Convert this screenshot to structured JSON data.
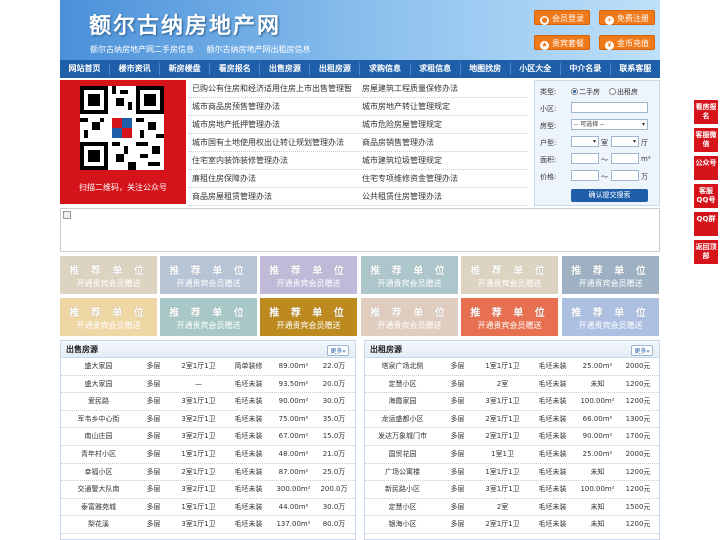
{
  "header": {
    "title": "额尔古纳房地产网",
    "subtitle": [
      "额尔古纳房地产网二手房信息",
      "额尔古纳房地产网出租房信息"
    ],
    "buttons": [
      {
        "label": "会员登录"
      },
      {
        "label": "免费注册"
      },
      {
        "label": "贵宾套餐"
      },
      {
        "label": "金币充值"
      }
    ]
  },
  "nav": [
    "网站首页",
    "楼市资讯",
    "新房楼盘",
    "看房报名",
    "出售房源",
    "出租房源",
    "求购信息",
    "求租信息",
    "地图找房",
    "小区大全",
    "中介名录",
    "联系客服"
  ],
  "qr": {
    "caption": "扫描二维码，关注公众号"
  },
  "links": [
    [
      "已购公有住房和经济适用住房上市出售管理暂",
      "房屋建筑工程质量保修办法"
    ],
    [
      "城市商品房预售管理办法",
      "城市房地产转让管理规定"
    ],
    [
      "城市房地产抵押管理办法",
      "城市危险房屋管理规定"
    ],
    [
      "城市国有土地使用权出让转让规划管理办法",
      "商品房销售管理办法"
    ],
    [
      "住宅室内装饰装修管理办法",
      "城市建筑垃圾管理规定"
    ],
    [
      "廉租住房保障办法",
      "住宅专项维修资金管理办法"
    ],
    [
      "商品房屋租赁管理办法",
      "公共租赁住房管理办法"
    ]
  ],
  "search": {
    "type_label": "类型:",
    "opt1": "二手房",
    "opt2": "出租房",
    "area_label": "小区:",
    "room_label": "房型:",
    "room_select": "-- 可选择 --",
    "layout_label": "户型:",
    "shi": "室",
    "ting": "厅",
    "size_label": "面积:",
    "price_label": "价格:",
    "unit_m2": "m²",
    "unit_wan": "万",
    "tilde": "〜",
    "submit": "确认提交搜索"
  },
  "ads": [
    {
      "l1": "推 荐 单 位",
      "l2": "开通贵宾会员赠送",
      "color": "#ddd3c1"
    },
    {
      "l1": "推 荐 单 位",
      "l2": "开通贵宾会员赠送",
      "color": "#b7c4d6"
    },
    {
      "l1": "推 荐 单 位",
      "l2": "开通贵宾会员赠送",
      "color": "#c0b9d7"
    },
    {
      "l1": "推 荐 单 位",
      "l2": "开通贵宾会员赠送",
      "color": "#acc6cb"
    },
    {
      "l1": "推 荐 单 位",
      "l2": "开通贵宾会员赠送",
      "color": "#ddd3c1"
    },
    {
      "l1": "推 荐 单 位",
      "l2": "开通贵宾会员赠送",
      "color": "#9db1c2"
    },
    {
      "l1": "推 荐 单 位",
      "l2": "开通贵宾会员赠送",
      "color": "#efd6a5"
    },
    {
      "l1": "推 荐 单 位",
      "l2": "开通贵宾会员赠送",
      "color": "#a8c8c7"
    },
    {
      "l1": "推 荐 单 位",
      "l2": "开通贵宾会员赠送",
      "color": "#bd8a1f"
    },
    {
      "l1": "推 荐 单 位",
      "l2": "开通贵宾会员赠送",
      "color": "#e0cdc0"
    },
    {
      "l1": "推 荐 单 位",
      "l2": "开通贵宾会员赠送",
      "color": "#e6704f"
    },
    {
      "l1": "推 荐 单 位",
      "l2": "开通贵宾会员赠送",
      "color": "#aec0e2"
    }
  ],
  "sale": {
    "title": "出售房源",
    "more": "更多»",
    "rows": [
      [
        "盛大家园",
        "多层",
        "2室1厅1卫",
        "简单装修",
        "89.00m²",
        "22.0万"
      ],
      [
        "盛大家园",
        "多层",
        "—",
        "毛坯未装",
        "93.50m²",
        "20.0万"
      ],
      [
        "爱民路",
        "多层",
        "3室1厅1卫",
        "毛坯未装",
        "90.00m²",
        "30.0万"
      ],
      [
        "军韦乡中心街",
        "多层",
        "3室2厅1卫",
        "毛坯未装",
        "75.00m²",
        "35.0万"
      ],
      [
        "南山庄园",
        "多层",
        "3室2厅1卫",
        "毛坯未装",
        "67.00m²",
        "15.0万"
      ],
      [
        "青年村小区",
        "多层",
        "1室1厅1卫",
        "毛坯未装",
        "48.00m²",
        "21.0万"
      ],
      [
        "幸福小区",
        "多层",
        "2室1厅1卫",
        "毛坯未装",
        "87.00m²",
        "25.0万"
      ],
      [
        "交通警大队南",
        "多层",
        "3室2厅1卫",
        "毛坯未装",
        "300.00m²",
        "200.0万"
      ],
      [
        "泰富雅苑城",
        "多层",
        "1室1厅1卫",
        "毛坯未装",
        "44.00m²",
        "30.0万"
      ],
      [
        "梨花溪",
        "多层",
        "3室1厅1卫",
        "毛坯未装",
        "137.00m²",
        "80.0万"
      ]
    ]
  },
  "rent": {
    "title": "出租房源",
    "more": "更多»",
    "rows": [
      [
        "塔泉广场北侧",
        "多层",
        "1室1厅1卫",
        "毛坯未装",
        "25.00m²",
        "2000元"
      ],
      [
        "定慧小区",
        "多层",
        "2室",
        "毛坯未装",
        "未知",
        "1200元"
      ],
      [
        "海霞家园",
        "多层",
        "3室1厅1卫",
        "毛坯未装",
        "100.00m²",
        "1200元"
      ],
      [
        "龙运盛都小区",
        "多层",
        "2室1厅1卫",
        "毛坯未装",
        "66.00m²",
        "1300元"
      ],
      [
        "发达万象城门市",
        "多层",
        "2室1厅1卫",
        "毛坯未装",
        "90.00m²",
        "1700元"
      ],
      [
        "国贸花园",
        "多层",
        "1室1卫",
        "毛坯未装",
        "25.00m²",
        "2000元"
      ],
      [
        "广场公寓楼",
        "多层",
        "1室1厅1卫",
        "毛坯未装",
        "未知",
        "1200元"
      ],
      [
        "新民路小区",
        "多层",
        "3室1厅1卫",
        "毛坯未装",
        "100.00m²",
        "1200元"
      ],
      [
        "定慧小区",
        "多层",
        "2室",
        "毛坯未装",
        "未知",
        "1500元"
      ],
      [
        "银海小区",
        "多层",
        "2室1厅1卫",
        "毛坯未装",
        "未知",
        "1200元"
      ]
    ]
  },
  "sidebar": [
    "看房报名",
    "客服微信",
    "公众号",
    "客服QQ号",
    "QQ群",
    "返回顶部"
  ]
}
